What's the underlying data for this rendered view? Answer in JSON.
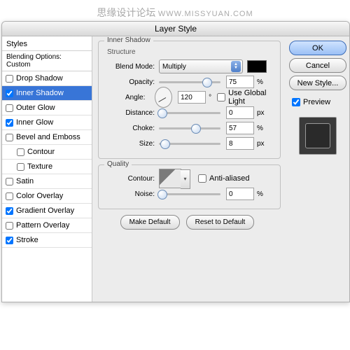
{
  "watermark": {
    "cn": "思缘设计论坛",
    "url": "WWW.MISSYUAN.COM"
  },
  "window": {
    "title": "Layer Style"
  },
  "sidebar": {
    "head": "Styles",
    "opt": "Blending Options: Custom",
    "items": [
      {
        "label": "Drop Shadow",
        "checked": false,
        "sel": false,
        "sub": false
      },
      {
        "label": "Inner Shadow",
        "checked": true,
        "sel": true,
        "sub": false
      },
      {
        "label": "Outer Glow",
        "checked": false,
        "sel": false,
        "sub": false
      },
      {
        "label": "Inner Glow",
        "checked": true,
        "sel": false,
        "sub": false
      },
      {
        "label": "Bevel and Emboss",
        "checked": false,
        "sel": false,
        "sub": false
      },
      {
        "label": "Contour",
        "checked": false,
        "sel": false,
        "sub": true
      },
      {
        "label": "Texture",
        "checked": false,
        "sel": false,
        "sub": true
      },
      {
        "label": "Satin",
        "checked": false,
        "sel": false,
        "sub": false
      },
      {
        "label": "Color Overlay",
        "checked": false,
        "sel": false,
        "sub": false
      },
      {
        "label": "Gradient Overlay",
        "checked": true,
        "sel": false,
        "sub": false
      },
      {
        "label": "Pattern Overlay",
        "checked": false,
        "sel": false,
        "sub": false
      },
      {
        "label": "Stroke",
        "checked": true,
        "sel": false,
        "sub": false
      }
    ]
  },
  "panel": {
    "title": "Inner Shadow",
    "structure": {
      "label": "Structure",
      "blendmode_lbl": "Blend Mode:",
      "blendmode_val": "Multiply",
      "swatch": "#000000",
      "opacity_lbl": "Opacity:",
      "opacity_val": "75",
      "opacity_unit": "%",
      "angle_lbl": "Angle:",
      "angle_val": "120",
      "angle_unit": "°",
      "ugl_lbl": "Use Global Light",
      "ugl_checked": false,
      "distance_lbl": "Distance:",
      "distance_val": "0",
      "distance_unit": "px",
      "choke_lbl": "Choke:",
      "choke_val": "57",
      "choke_unit": "%",
      "size_lbl": "Size:",
      "size_val": "8",
      "size_unit": "px"
    },
    "quality": {
      "label": "Quality",
      "contour_lbl": "Contour:",
      "aa_lbl": "Anti-aliased",
      "aa_checked": false,
      "noise_lbl": "Noise:",
      "noise_val": "0",
      "noise_unit": "%"
    },
    "buttons": {
      "make_default": "Make Default",
      "reset": "Reset to Default"
    }
  },
  "right": {
    "ok": "OK",
    "cancel": "Cancel",
    "newstyle": "New Style...",
    "preview_lbl": "Preview",
    "preview_checked": true
  }
}
